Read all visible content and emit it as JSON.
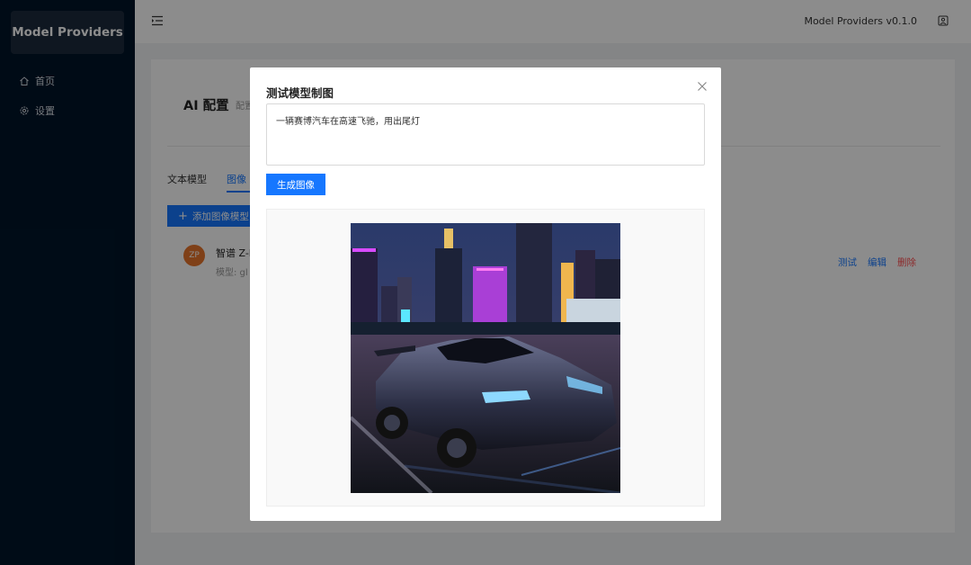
{
  "sidebar": {
    "logo": "Model Providers",
    "items": [
      {
        "label": "首页",
        "icon": "home-icon"
      },
      {
        "label": "设置",
        "icon": "gear-icon"
      }
    ]
  },
  "header": {
    "title": "Model Providers v0.1.0",
    "menu_icon": "menu-fold-icon",
    "user_icon": "user-icon"
  },
  "page": {
    "title": "AI 配置",
    "subtitle_fragment": "配置",
    "tabs": [
      {
        "label": "文本模型"
      },
      {
        "label": "图像模型",
        "visible": "图像"
      }
    ],
    "add_button": "添加图像模型",
    "provider": {
      "avatar": "ZP",
      "name": "智谱 Z-I",
      "model_fragment": "模型: gl"
    },
    "actions": {
      "test": "测试",
      "edit": "编辑",
      "delete": "删除"
    }
  },
  "modal": {
    "title": "测试模型制图",
    "prompt_value": "一辆赛博汽车在高速飞驰，用出尾灯",
    "generate_button": "生成图像",
    "image_icon": "generated-car-image"
  },
  "colors": {
    "primary": "#1677ff",
    "danger": "#ff4d4f",
    "sidebar_bg": "#001529",
    "avatar_bg": "#e8762d"
  }
}
